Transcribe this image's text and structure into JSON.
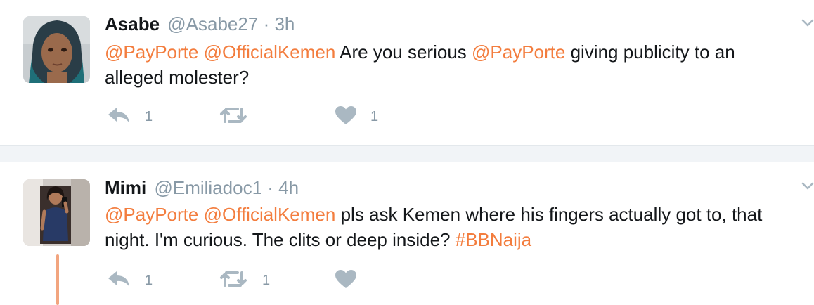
{
  "tweets": [
    {
      "fullname": "Asabe",
      "username": "@Asabe27",
      "separator": "·",
      "time": "3h",
      "text_lines": [
        [
          {
            "text": "@PayPorte",
            "link": true
          },
          {
            "text": " ",
            "link": false
          },
          {
            "text": "@OfficialKemen",
            "link": true
          },
          {
            "text": " Are you serious ",
            "link": false
          },
          {
            "text": "@PayPorte",
            "link": true
          },
          {
            "text": " giving publicity to an",
            "link": false
          }
        ],
        [
          {
            "text": "alleged molester?",
            "link": false
          }
        ]
      ],
      "reply_count": "1",
      "retweet_count": "",
      "like_count": "1",
      "icons": {
        "reply": "reply-icon",
        "retweet": "retweet-icon",
        "like": "heart-icon",
        "more": "chevron-down-icon"
      }
    },
    {
      "fullname": "Mimi",
      "username": "@Emiliadoc1",
      "separator": "·",
      "time": "4h",
      "text_lines": [
        [
          {
            "text": "@PayPorte",
            "link": true
          },
          {
            "text": " ",
            "link": false
          },
          {
            "text": "@OfficialKemen",
            "link": true
          },
          {
            "text": " pls ask Kemen where his fingers actually got to, that",
            "link": false
          }
        ],
        [
          {
            "text": "night. I'm curious. The clits or deep inside? ",
            "link": false
          },
          {
            "text": "#BBNaija",
            "link": true
          }
        ]
      ],
      "reply_count": "1",
      "retweet_count": "1",
      "like_count": "",
      "icons": {
        "reply": "reply-icon",
        "retweet": "retweet-icon",
        "like": "heart-icon",
        "more": "chevron-down-icon"
      }
    }
  ],
  "colors": {
    "link": "#f37d3e",
    "text": "#14171a",
    "muted": "#8899a6",
    "icon": "#aab8c2",
    "thread_line": "#f2a57f",
    "separator_bg": "#f1f4f7"
  }
}
